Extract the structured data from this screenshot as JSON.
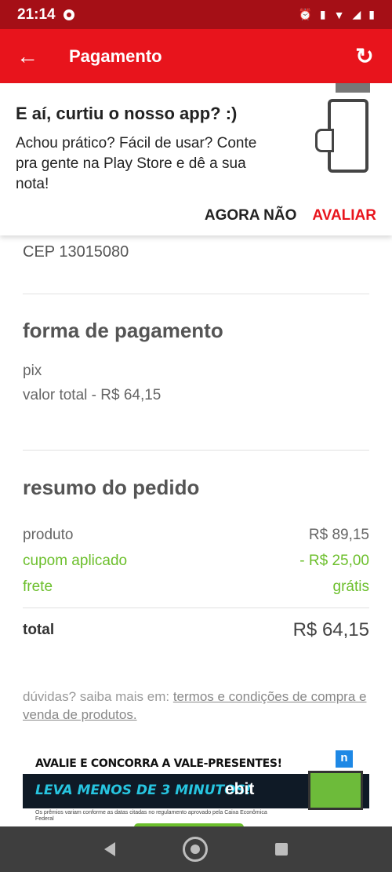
{
  "status_bar": {
    "time": "21:14"
  },
  "app_bar": {
    "title": "Pagamento"
  },
  "rating_prompt": {
    "question": "E aí, curtiu o nosso app? :)",
    "message": "Achou prático? Fácil de usar? Conte pra gente na Play Store e dê a sua nota!",
    "later_label": "AGORA NÃO",
    "rate_label": "AVALIAR"
  },
  "address": {
    "cep": "CEP 13015080"
  },
  "payment": {
    "heading": "forma de pagamento",
    "method": "pix",
    "total_line": "valor total - R$ 64,15"
  },
  "summary": {
    "heading": "resumo do pedido",
    "rows": [
      {
        "label": "produto",
        "value": "R$ 89,15"
      },
      {
        "label": "cupom aplicado",
        "value": "- R$ 25,00"
      },
      {
        "label": "frete",
        "value": "grátis"
      }
    ],
    "total_label": "total",
    "total_value": "R$ 64,15"
  },
  "footer": {
    "prefix": "dúvidas? saiba mais em: ",
    "link": "termos e condições de compra e venda de produtos."
  },
  "banner": {
    "headline": "AVALIE E CONCORRA A VALE-PRESENTES!",
    "message": "LEVA MENOS DE 3 MINUTOS!",
    "brand": "ebit",
    "fine_print": "Os prêmios variam conforme as datas citadas no regulamento aprovado pela Caixa Econômica Federal",
    "badge": "n"
  },
  "colors": {
    "brand_red": "#e8141c",
    "status_red": "#a50f16",
    "green": "#6cbf2c"
  }
}
